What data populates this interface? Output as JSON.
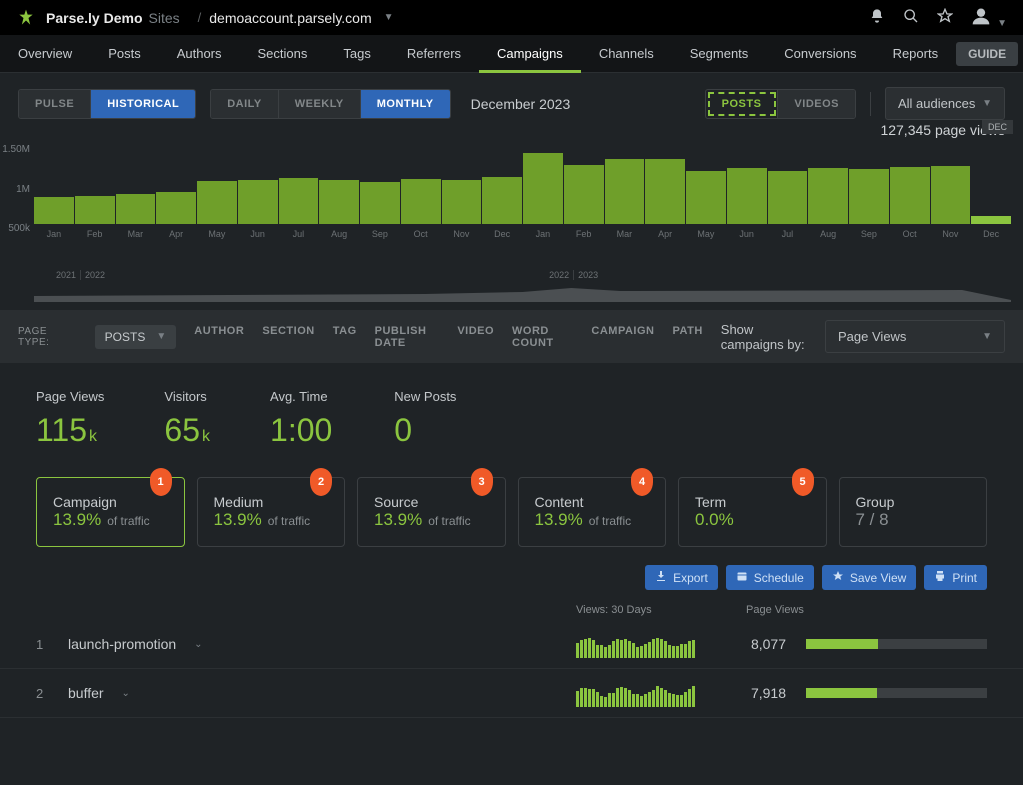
{
  "header": {
    "brand": "Parse.ly Demo",
    "sites_label": "Sites",
    "account": "demoaccount.parsely.com"
  },
  "nav": {
    "tabs": [
      "Overview",
      "Posts",
      "Authors",
      "Sections",
      "Tags",
      "Referrers",
      "Campaigns",
      "Channels",
      "Segments",
      "Conversions",
      "Reports"
    ],
    "active": "Campaigns",
    "guide": "GUIDE"
  },
  "controls": {
    "mode": [
      "PULSE",
      "HISTORICAL"
    ],
    "mode_active": "HISTORICAL",
    "grain": [
      "DAILY",
      "WEEKLY",
      "MONTHLY"
    ],
    "grain_active": "MONTHLY",
    "date_label": "December 2023",
    "content": [
      "POSTS",
      "VIDEOS"
    ],
    "content_active": "POSTS",
    "audience": "All audiences"
  },
  "total": {
    "label": "127,345 page views",
    "badge": "DEC"
  },
  "chart_data": {
    "type": "bar",
    "title": "",
    "xlabel": "",
    "ylabel": "",
    "ylim": [
      0,
      1500000
    ],
    "yticks": [
      "1.50M",
      "1M",
      "500k"
    ],
    "categories": [
      "Jan",
      "Feb",
      "Mar",
      "Apr",
      "May",
      "Jun",
      "Jul",
      "Aug",
      "Sep",
      "Oct",
      "Nov",
      "Dec",
      "Jan",
      "Feb",
      "Mar",
      "Apr",
      "May",
      "Jun",
      "Jul",
      "Aug",
      "Sep",
      "Oct",
      "Nov",
      "Dec"
    ],
    "values": [
      430000,
      450000,
      470000,
      500000,
      680000,
      700000,
      730000,
      700000,
      670000,
      710000,
      690000,
      750000,
      1120000,
      930000,
      1020000,
      1030000,
      830000,
      880000,
      840000,
      890000,
      870000,
      900000,
      920000,
      130000
    ],
    "years": [
      "2021",
      "2022",
      "2022",
      "2023"
    ]
  },
  "filter": {
    "pagetype_label": "PAGE TYPE:",
    "pagetype_value": "POSTS",
    "links": [
      "AUTHOR",
      "SECTION",
      "TAG",
      "PUBLISH DATE",
      "VIDEO",
      "WORD COUNT",
      "CAMPAIGN",
      "PATH"
    ],
    "show_label": "Show campaigns by:",
    "show_value": "Page Views"
  },
  "stats": [
    {
      "label": "Page Views",
      "value": "115",
      "suffix": "k"
    },
    {
      "label": "Visitors",
      "value": "65",
      "suffix": "k"
    },
    {
      "label": "Avg. Time",
      "value": "1:00",
      "suffix": ""
    },
    {
      "label": "New Posts",
      "value": "0",
      "suffix": ""
    }
  ],
  "cards": [
    {
      "n": "1",
      "title": "Campaign",
      "pct": "13.9%",
      "sub": "of traffic",
      "active": true
    },
    {
      "n": "2",
      "title": "Medium",
      "pct": "13.9%",
      "sub": "of traffic"
    },
    {
      "n": "3",
      "title": "Source",
      "pct": "13.9%",
      "sub": "of traffic"
    },
    {
      "n": "4",
      "title": "Content",
      "pct": "13.9%",
      "sub": "of traffic"
    },
    {
      "n": "5",
      "title": "Term",
      "pct": "0.0%",
      "sub": ""
    },
    {
      "title": "Group",
      "pct": "7 / 8",
      "dim": true
    }
  ],
  "actions": [
    "Export",
    "Schedule",
    "Save View",
    "Print"
  ],
  "action_icons": [
    "download-icon",
    "calendar-icon",
    "star-icon",
    "print-icon"
  ],
  "list": {
    "head_views": "Views: 30 Days",
    "head_pv": "Page Views",
    "rows": [
      {
        "idx": "1",
        "name": "launch-promotion",
        "views": "8,077",
        "fill": 40
      },
      {
        "idx": "2",
        "name": "buffer",
        "views": "7,918",
        "fill": 39
      }
    ]
  }
}
